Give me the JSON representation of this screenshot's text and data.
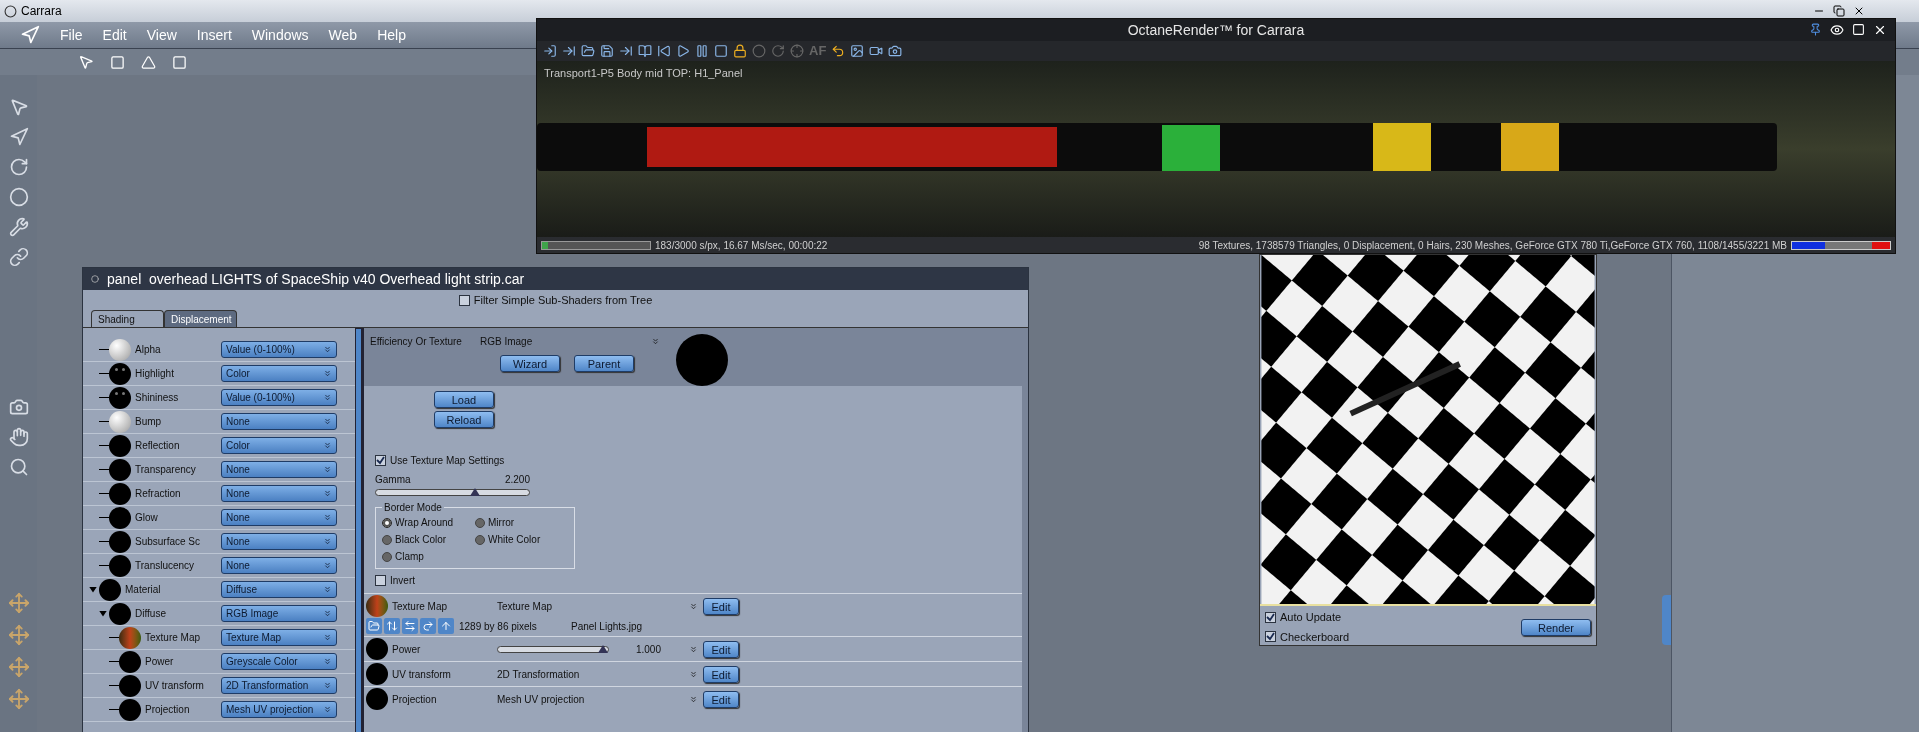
{
  "app": {
    "title": "Carrara",
    "menu": [
      "File",
      "Edit",
      "View",
      "Insert",
      "Windows",
      "Web",
      "Help"
    ]
  },
  "octane": {
    "title": "OctaneRender™ for Carrara",
    "toolbar_text": "AF",
    "caption": "Transport1-P5 Body mid TOP: H1_Panel",
    "progress": {
      "level": 0.06,
      "reading": "183/3000 s/px, 16.67 Ms/sec, 00:00:22"
    },
    "stats": "98 Textures, 1738579 Triangles, 0 Displacement, 0 Hairs, 230 Meshes, GeForce GTX 780 Ti,GeForce GTX 760, 1108/1455/3221 MB",
    "memory": {
      "level": 0.34
    }
  },
  "shader": {
    "title": "panel  overhead LIGHTS of SpaceShip v40 Overhead light strip.car",
    "filter": {
      "label": "Filter Simple Sub-Shaders from Tree",
      "checked": false
    },
    "tabs": [
      {
        "label": "Shading",
        "selected": true
      },
      {
        "label": "Displacement",
        "selected": false
      }
    ],
    "tree": [
      {
        "children": [
          {
            "label": "Alpha",
            "value": "Value (0-100%)",
            "kind": "white"
          },
          {
            "label": "Highlight",
            "value": "Color",
            "kind": "eyes"
          },
          {
            "label": "Shininess",
            "value": "Value (0-100%)",
            "kind": "eyes"
          },
          {
            "label": "Bump",
            "value": "None",
            "kind": "white"
          },
          {
            "label": "Reflection",
            "value": "Color",
            "kind": "black"
          },
          {
            "label": "Transparency",
            "value": "None",
            "kind": "black"
          },
          {
            "label": "Refraction",
            "value": "None",
            "kind": "black"
          },
          {
            "label": "Glow",
            "value": "None",
            "kind": "black"
          },
          {
            "label": "Subsurface Sc",
            "value": "None",
            "kind": "black"
          },
          {
            "label": "Translucency",
            "value": "None",
            "kind": "black"
          }
        ]
      },
      {
        "label": "Material",
        "value": "Diffuse",
        "kind": "black",
        "expanded": true,
        "children": [
          {
            "label": "Diffuse",
            "value": "RGB Image",
            "kind": "black",
            "expanded": true,
            "children": [
              {
                "label": "Texture Map",
                "value": "Texture Map",
                "kind": "texture"
              },
              {
                "label": "Power",
                "value": "Greyscale Color",
                "kind": "black"
              },
              {
                "label": "UV transform",
                "value": "2D Transformation",
                "kind": "black"
              },
              {
                "label": "Projection",
                "value": "Mesh UV projection",
                "kind": "black"
              }
            ]
          }
        ]
      }
    ],
    "editor": {
      "channel": "Efficiency Or Texture",
      "value": "RGB Image",
      "buttons": [
        "Wizard",
        "Parent"
      ],
      "file_buttons": [
        "Load",
        "Reload"
      ],
      "use_settings": {
        "label": "Use Texture Map Settings",
        "checked": true
      },
      "gamma": {
        "label": "Gamma",
        "reading": "2.200",
        "level": 0.65
      },
      "border": {
        "title": "Border Mode",
        "options": [
          {
            "label": "Wrap Around",
            "selected": true
          },
          {
            "label": "Mirror",
            "selected": false
          },
          {
            "label": "Black Color",
            "selected": false
          },
          {
            "label": "White Color",
            "selected": false
          },
          {
            "label": "Clamp",
            "selected": false
          }
        ]
      },
      "invert": {
        "label": "Invert",
        "checked": false
      },
      "rows": [
        {
          "kind": "texture",
          "label": "Texture Map",
          "value": "Texture Map",
          "button": "Edit",
          "size": "1289 by 86 pixels",
          "file": "Panel Lights.jpg"
        },
        {
          "kind": "slider",
          "label": "Power",
          "level": 0.95,
          "reading": "1.000",
          "button": "Edit"
        },
        {
          "kind": "select",
          "label": "UV transform",
          "value": "2D Transformation",
          "button": "Edit"
        },
        {
          "kind": "select",
          "label": "Projection",
          "value": "Mesh UV projection",
          "button": "Edit"
        }
      ]
    }
  },
  "preview": {
    "options": [
      {
        "label": "Auto Update",
        "checked": true
      },
      {
        "label": "Checkerboard",
        "checked": true
      }
    ],
    "button": "Render"
  }
}
